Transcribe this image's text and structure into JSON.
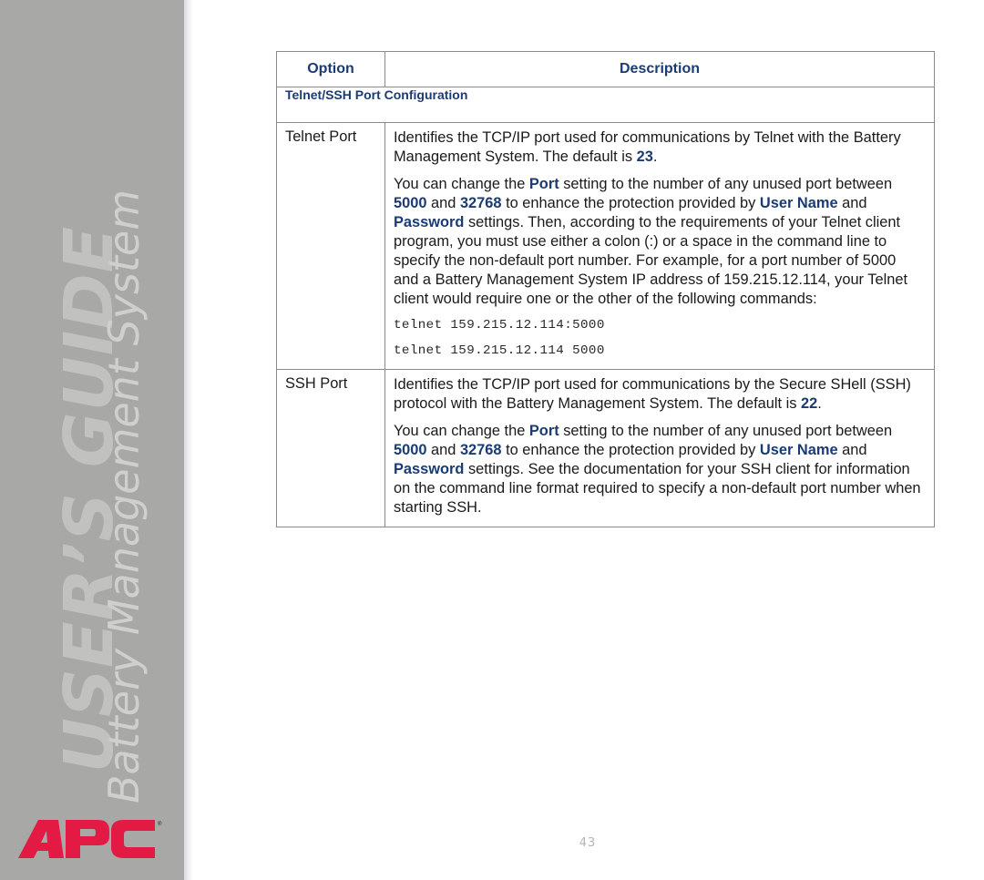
{
  "sidebar": {
    "guide_title": "USER’S GUIDE",
    "product_name": "Battery Management System",
    "logo_text": "APC",
    "logo_mark": "®",
    "logo_color": "#e31b44",
    "background_color": "#a8a8a6"
  },
  "table": {
    "headers": {
      "option": "Option",
      "description": "Description"
    },
    "section_title": "Telnet/SSH Port Configuration",
    "rows": [
      {
        "option": "Telnet Port",
        "para1": {
          "text": "Identifies the TCP/IP port used for communications by Telnet with the Battery Management System. The default is ",
          "default_value": "23",
          "end": "."
        },
        "para2": {
          "t1": "You can change the ",
          "port": "Port",
          "t2": " setting to the number of any unused port between ",
          "min": "5000",
          "t3": " and ",
          "max": "32768",
          "t4": " to enhance the protection provided by ",
          "user_name": "User Name",
          "t5": " and ",
          "password": "Password",
          "t6": " settings. Then, according to the requirements of your Telnet client program, you must use either a colon (:) or a space in the command line to specify the non-default port number. For example, for a port number of 5000 and a Battery Management System IP address of 159.215.12.114, your Telnet client would require one or the other of the following commands:"
        },
        "commands": [
          "telnet 159.215.12.114:5000",
          "telnet 159.215.12.114 5000"
        ]
      },
      {
        "option": "SSH Port",
        "para1": {
          "text": "Identifies the TCP/IP port used for communications by the Secure SHell (SSH) protocol with the Battery Management System. The default is ",
          "default_value": "22",
          "end": "."
        },
        "para2": {
          "t1": "You can change the ",
          "port": "Port",
          "t2": " setting to the number of any unused port between ",
          "min": "5000",
          "t3": " and ",
          "max": "32768",
          "t4": " to enhance the protection provided by ",
          "user_name": "User Name",
          "t5": " and ",
          "password": "Password",
          "t6": " settings. See the documentation for your SSH client for information on the command line format required to specify a non-default port number when starting SSH."
        }
      }
    ]
  },
  "colors": {
    "heading_blue": "#1b3b73",
    "border": "#8a8a8a"
  },
  "page_number": "43"
}
